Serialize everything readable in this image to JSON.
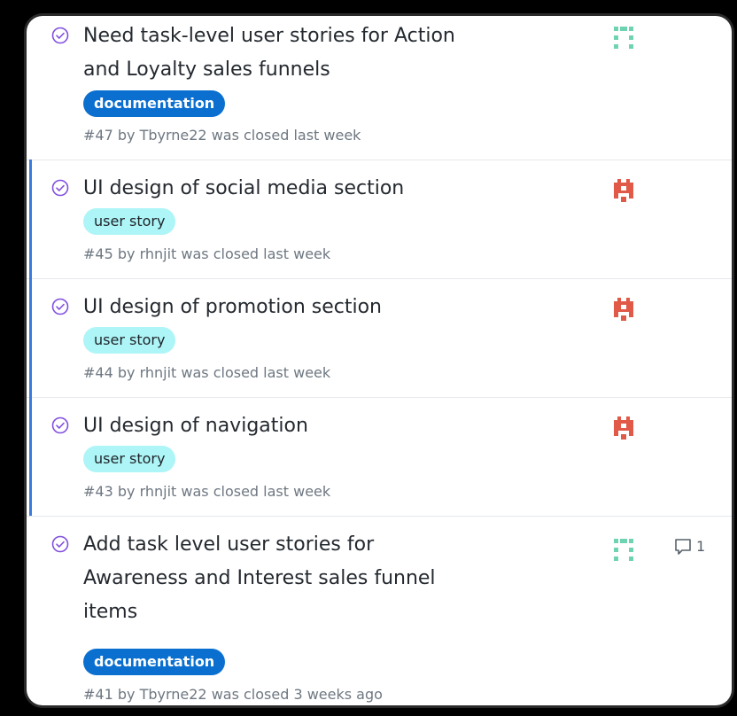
{
  "issues": [
    {
      "title": "Need task-level user stories for Action and Loyalty sales funnels",
      "label": "documentation",
      "meta": "#47 by Tbyrne22 was closed last week",
      "avatar": "teal-avatar-icon"
    },
    {
      "title": "UI design of social media section",
      "label": "user story",
      "meta": "#45 by rhnjit was closed last week",
      "avatar": "red-avatar-icon"
    },
    {
      "title": "UI design of promotion section",
      "label": "user story",
      "meta": "#44 by rhnjit was closed last week",
      "avatar": "red-avatar-icon"
    },
    {
      "title": "UI design of navigation",
      "label": "user story",
      "meta": "#43 by rhnjit was closed last week",
      "avatar": "red-avatar-icon"
    },
    {
      "title": "Add task level user stories for Awareness and Interest sales funnel items",
      "label": "documentation",
      "meta": "#41 by Tbyrne22 was closed 3 weeks ago",
      "avatar": "teal-avatar-icon",
      "comments": "1"
    }
  ],
  "colors": {
    "closed_icon": "#8250df",
    "documentation_label": "#0a6fcf",
    "user_story_label": "#adf5f7",
    "accent_border": "#3b7bd9",
    "teal_avatar": "#6fd3b0",
    "red_avatar": "#e05a47"
  }
}
